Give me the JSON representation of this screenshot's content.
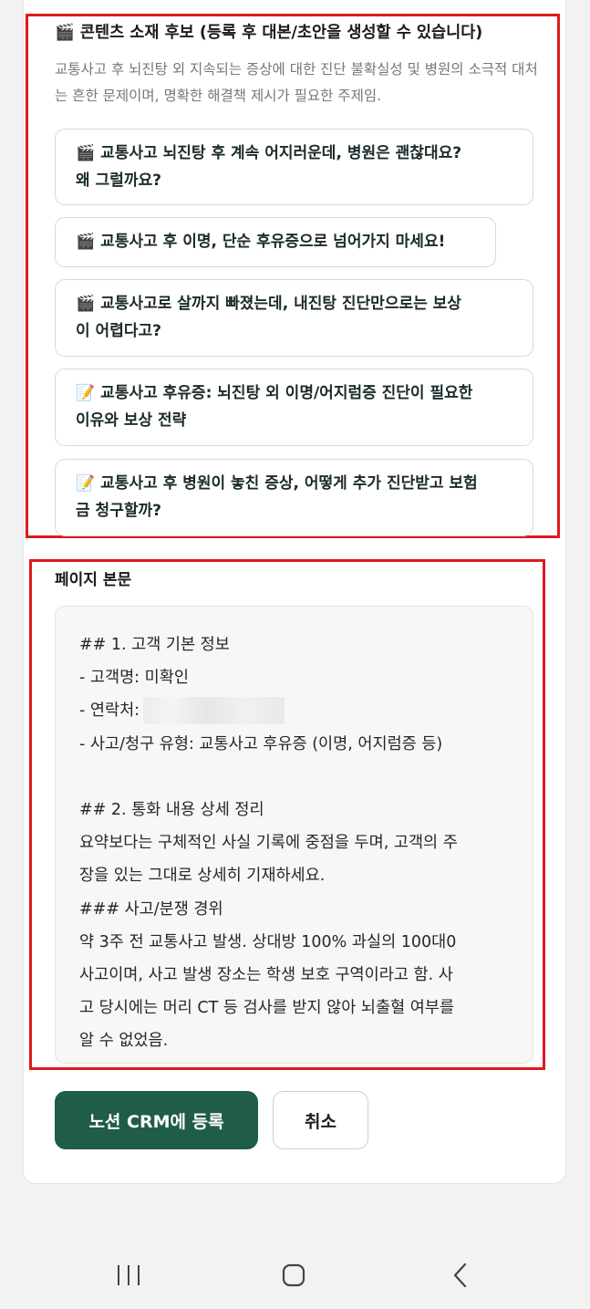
{
  "content_candidates": {
    "title": "🎬 콘텐츠 소재 후보 (등록 후 대본/초안을 생성할 수 있습니다)",
    "description": "교통사고 후 뇌진탕 외 지속되는 증상에 대한 진단 불확실성 및 병원의 소극적 대처는 흔한 문제이며, 명확한 해결책 제시가 필요한 주제임.",
    "items": [
      {
        "emoji": "🎬",
        "text_line1": "교통사고 뇌진탕 후 계속 어지러운데, 병원은 괜찮대요?",
        "text_line2": "왜 그럴까요?"
      },
      {
        "emoji": "🎬",
        "text_line1": "교통사고 후 이명, 단순 후유증으로 넘어가지 마세요!",
        "text_line2": ""
      },
      {
        "emoji": "🎬",
        "text_line1": "교통사고로 살까지 빠졌는데, 내진탕 진단만으로는 보상",
        "text_line2": "이 어렵다고?"
      },
      {
        "emoji": "📝",
        "text_line1": "교통사고 후유증: 뇌진탕 외 이명/어지럼증 진단이 필요한",
        "text_line2": "이유와 보상 전략"
      },
      {
        "emoji": "📝",
        "text_line1": "교통사고 후 병원이 놓친 증상, 어떻게 추가 진단받고 보험",
        "text_line2": "금 청구할까?"
      }
    ]
  },
  "page_body": {
    "label": "페이지 본문",
    "lines": [
      "## 1. 고객 기본 정보",
      "- 고객명: 미확인",
      "- 연락처:",
      "- 사고/청구 유형: 교통사고 후유증 (이명, 어지럼증 등)",
      "",
      "## 2. 통화 내용 상세 정리",
      "요약보다는 구체적인 사실 기록에 중점을 두며, 고객의 주",
      "장을 있는 그대로 상세히 기재하세요.",
      "### 사고/분쟁 경위",
      "약 3주 전 교통사고 발생. 상대방 100% 과실의 100대0",
      "사고이며, 사고 발생 장소는 학생 보호 구역이라고 함. 사",
      "고 당시에는 머리 CT 등 검사를 받지 않아 뇌출혈 여부를",
      "알 수 없었음."
    ]
  },
  "actions": {
    "register_label": "노션 CRM에 등록",
    "cancel_label": "취소"
  },
  "colors": {
    "primary": "#1f5c4a",
    "highlight": "#e0191e"
  },
  "nav": {
    "icons": [
      "recent-apps-icon",
      "home-icon",
      "back-icon"
    ]
  }
}
